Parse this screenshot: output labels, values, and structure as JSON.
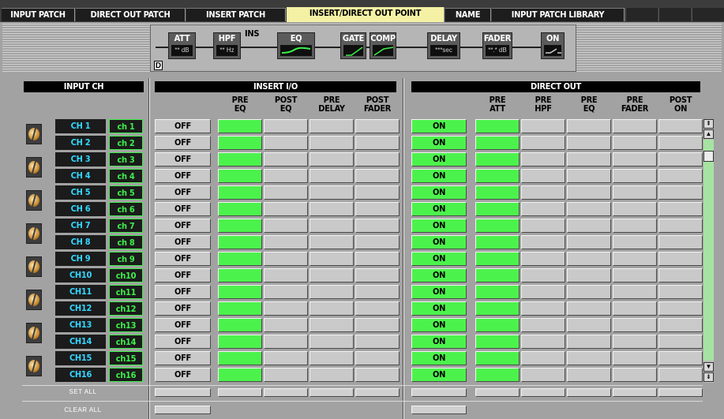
{
  "tabs": [
    {
      "label": "INPUT PATCH",
      "active": false
    },
    {
      "label": "DIRECT OUT PATCH",
      "active": false
    },
    {
      "label": "INSERT PATCH",
      "active": false
    },
    {
      "label": "INSERT/DIRECT OUT POINT",
      "active": true
    },
    {
      "label": "NAME",
      "active": false
    },
    {
      "label": "INPUT PATCH LIBRARY",
      "active": false
    }
  ],
  "signal_flow": {
    "d_badge": "D",
    "ins_badge": "INS",
    "blocks": [
      {
        "label": "ATT",
        "value": "** dB"
      },
      {
        "label": "HPF",
        "value": "** Hz"
      },
      {
        "label": "EQ",
        "value": ""
      },
      {
        "label": "GATE",
        "value": ""
      },
      {
        "label": "COMP",
        "value": ""
      },
      {
        "label": "DELAY",
        "value": "***sec"
      },
      {
        "label": "FADER",
        "value": "**.* dB"
      },
      {
        "label": "ON",
        "value": ""
      }
    ]
  },
  "sections": {
    "input_ch": "INPUT CH",
    "insert_io": "INSERT I/O",
    "direct_out": "DIRECT OUT"
  },
  "insert_columns": [
    {
      "line1": "PRE",
      "line2": "EQ"
    },
    {
      "line1": "POST",
      "line2": "EQ"
    },
    {
      "line1": "PRE",
      "line2": "DELAY"
    },
    {
      "line1": "POST",
      "line2": "FADER"
    }
  ],
  "direct_columns": [
    {
      "line1": "PRE",
      "line2": "ATT"
    },
    {
      "line1": "PRE",
      "line2": "HPF"
    },
    {
      "line1": "PRE",
      "line2": "EQ"
    },
    {
      "line1": "PRE",
      "line2": "FADER"
    },
    {
      "line1": "POST",
      "line2": "ON"
    }
  ],
  "labels": {
    "off": "OFF",
    "on": "ON",
    "set_all": "SET ALL",
    "clear_all": "CLEAR ALL"
  },
  "channels": [
    {
      "name": "CH 1",
      "patch": "ch 1"
    },
    {
      "name": "CH 2",
      "patch": "ch 2"
    },
    {
      "name": "CH 3",
      "patch": "ch 3"
    },
    {
      "name": "CH 4",
      "patch": "ch 4"
    },
    {
      "name": "CH 5",
      "patch": "ch 5"
    },
    {
      "name": "CH 6",
      "patch": "ch 6"
    },
    {
      "name": "CH 7",
      "patch": "ch 7"
    },
    {
      "name": "CH 8",
      "patch": "ch 8"
    },
    {
      "name": "CH 9",
      "patch": "ch 9"
    },
    {
      "name": "CH10",
      "patch": "ch10"
    },
    {
      "name": "CH11",
      "patch": "ch11"
    },
    {
      "name": "CH12",
      "patch": "ch12"
    },
    {
      "name": "CH13",
      "patch": "ch13"
    },
    {
      "name": "CH14",
      "patch": "ch14"
    },
    {
      "name": "CH15",
      "patch": "ch15"
    },
    {
      "name": "CH16",
      "patch": "ch16"
    }
  ],
  "insert_point_selected": "PRE EQ",
  "direct_out_point_selected": "PRE ATT",
  "colors": {
    "selected": "#4cf24c",
    "channel_name": "#33d6ff",
    "patch_name": "#3cf04a",
    "active_tab": "#f4f1a4"
  }
}
